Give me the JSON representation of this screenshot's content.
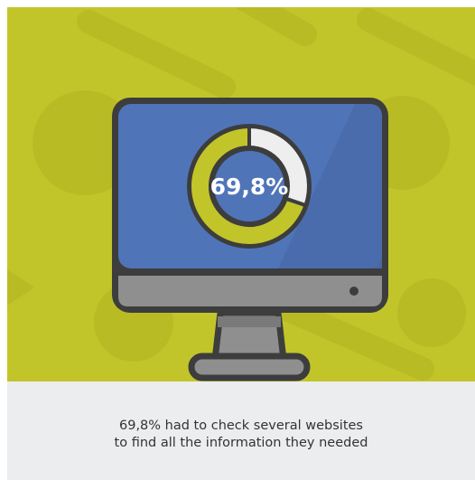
{
  "stat": {
    "value_text": "69,8%",
    "percent": 69.8
  },
  "caption": {
    "line1": "69,8% had to check several websites",
    "line2": "to find all the information they needed"
  },
  "colors": {
    "background_green": "#c2c529",
    "screen_blue": "#4f75b8",
    "donut_filled": "#c2c529",
    "donut_remaining": "#eeeeee",
    "monitor_outline": "#3d3d3d",
    "monitor_body": "#8f8f8f",
    "caption_panel": "#ecedef"
  },
  "icons": {
    "monitor": "desktop-monitor-icon",
    "donut": "donut-chart-icon"
  }
}
